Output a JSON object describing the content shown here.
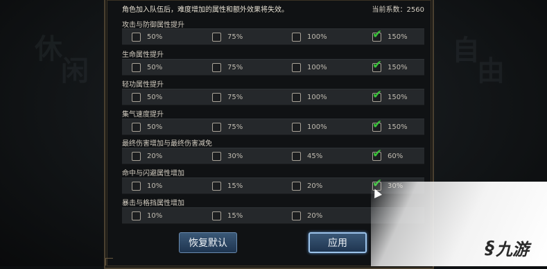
{
  "background_glyphs": [
    "休",
    "闲",
    "自",
    "由"
  ],
  "header": {
    "note": "角色加入队伍后，难度增加的属性和额外效果将失效。",
    "coefficient": "当前系数：2560"
  },
  "sections": [
    {
      "title": "攻击与防御属性提升",
      "options": [
        {
          "label": "50%",
          "checked": false
        },
        {
          "label": "75%",
          "checked": false
        },
        {
          "label": "100%",
          "checked": false
        },
        {
          "label": "150%",
          "checked": true
        }
      ]
    },
    {
      "title": "生命属性提升",
      "options": [
        {
          "label": "50%",
          "checked": false
        },
        {
          "label": "75%",
          "checked": false
        },
        {
          "label": "100%",
          "checked": false
        },
        {
          "label": "150%",
          "checked": true
        }
      ]
    },
    {
      "title": "轻功属性提升",
      "options": [
        {
          "label": "50%",
          "checked": false
        },
        {
          "label": "75%",
          "checked": false
        },
        {
          "label": "100%",
          "checked": false
        },
        {
          "label": "150%",
          "checked": true
        }
      ]
    },
    {
      "title": "集气速度提升",
      "options": [
        {
          "label": "50%",
          "checked": false
        },
        {
          "label": "75%",
          "checked": false
        },
        {
          "label": "100%",
          "checked": false
        },
        {
          "label": "150%",
          "checked": true
        }
      ]
    },
    {
      "title": "最终伤害增加与最终伤害减免",
      "options": [
        {
          "label": "20%",
          "checked": false
        },
        {
          "label": "30%",
          "checked": false
        },
        {
          "label": "45%",
          "checked": false
        },
        {
          "label": "60%",
          "checked": true
        }
      ]
    },
    {
      "title": "命中与闪避属性增加",
      "options": [
        {
          "label": "10%",
          "checked": false
        },
        {
          "label": "15%",
          "checked": false
        },
        {
          "label": "20%",
          "checked": false
        },
        {
          "label": "30%",
          "checked": true
        }
      ]
    },
    {
      "title": "暴击与格挡属性增加",
      "options": [
        {
          "label": "10%",
          "checked": false
        },
        {
          "label": "15%",
          "checked": false
        },
        {
          "label": "20%",
          "checked": false
        }
      ]
    }
  ],
  "buttons": {
    "reset": "恢复默认",
    "apply": "应用"
  },
  "watermark": {
    "text": "九游",
    "icon": "swirl-logo-icon"
  },
  "colors": {
    "check": "#39c23a",
    "button": "#2c4766",
    "panel_border": "#4a4030"
  }
}
